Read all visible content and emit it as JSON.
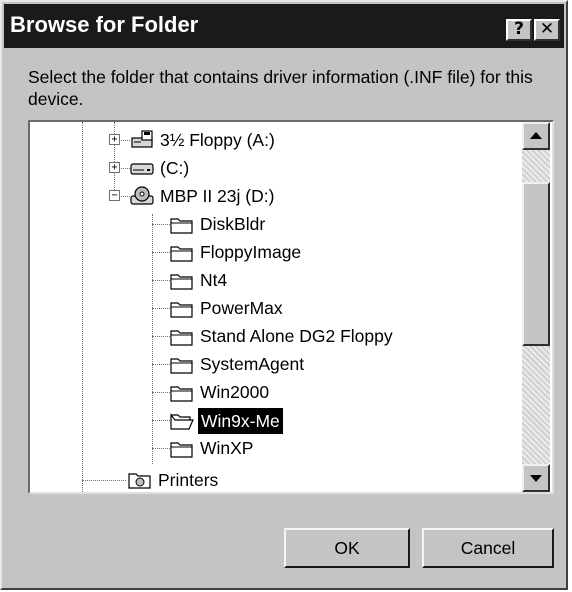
{
  "dialog": {
    "title": "Browse for Folder",
    "help_label": "?",
    "close_label": "✕",
    "description": "Select the folder that contains driver information (.INF file) for this device."
  },
  "tree": {
    "items": [
      {
        "label": "3½ Floppy (A:)",
        "icon": "floppy-drive-icon",
        "expander": "+"
      },
      {
        "label": "(C:)",
        "icon": "hard-drive-icon",
        "expander": "+"
      },
      {
        "label": "MBP II 23j (D:)",
        "icon": "cd-drive-icon",
        "expander": "−"
      },
      {
        "label": "DiskBldr",
        "icon": "folder-icon"
      },
      {
        "label": "FloppyImage",
        "icon": "folder-icon"
      },
      {
        "label": "Nt4",
        "icon": "folder-icon"
      },
      {
        "label": "PowerMax",
        "icon": "folder-icon"
      },
      {
        "label": "Stand Alone DG2 Floppy",
        "icon": "folder-icon"
      },
      {
        "label": "SystemAgent",
        "icon": "folder-icon"
      },
      {
        "label": "Win2000",
        "icon": "folder-icon"
      },
      {
        "label": "Win9x-Me",
        "icon": "open-folder-icon",
        "selected": true
      },
      {
        "label": "WinXP",
        "icon": "folder-icon"
      },
      {
        "label": "Printers",
        "icon": "printers-folder-icon"
      }
    ]
  },
  "buttons": {
    "ok": "OK",
    "cancel": "Cancel"
  }
}
